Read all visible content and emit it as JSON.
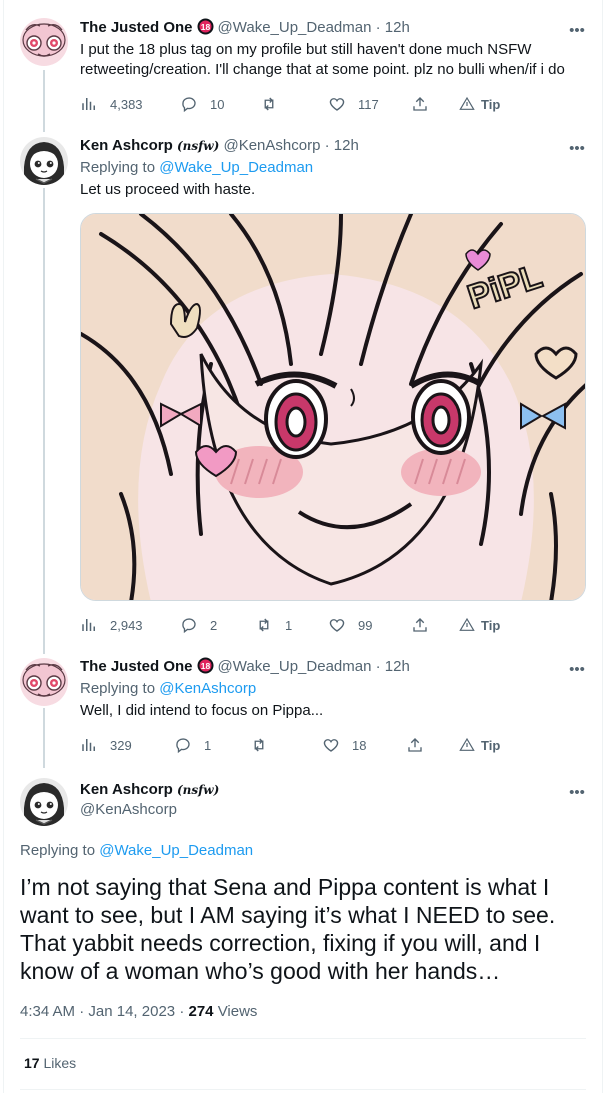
{
  "tweets": [
    {
      "name": "The Justed One",
      "badge": "18",
      "handle": "@Wake_Up_Deadman",
      "sep": "·",
      "time": "12h",
      "text": "I put the 18 plus tag on my profile but still haven't done much NSFW retweeting/creation. I'll change that at some point. plz no bulli when/if i do",
      "views": "4,383",
      "replies": "10",
      "retweets": "",
      "likes": "117",
      "tip": "Tip"
    },
    {
      "name": "Ken Ashcorp",
      "name_tag": "(nsfw)",
      "handle": "@KenAshcorp",
      "sep": "·",
      "time": "12h",
      "replying_prefix": "Replying to",
      "replying_to": "@Wake_Up_Deadman",
      "text": "Let us proceed with haste.",
      "views": "2,943",
      "replies": "2",
      "retweets": "1",
      "likes": "99",
      "tip": "Tip"
    },
    {
      "name": "The Justed One",
      "badge": "18",
      "handle": "@Wake_Up_Deadman",
      "sep": "·",
      "time": "12h",
      "replying_prefix": "Replying to",
      "replying_to": "@KenAshcorp",
      "text": "Well, I did intend to focus on Pippa...",
      "views": "329",
      "replies": "1",
      "retweets": "",
      "likes": "18",
      "tip": "Tip"
    }
  ],
  "main": {
    "name": "Ken Ashcorp",
    "name_tag": "(nsfw)",
    "handle": "@KenAshcorp",
    "replying_prefix": "Replying to",
    "replying_to": "@Wake_Up_Deadman",
    "text": "I’m not saying that Sena and Pippa content is what I want to see, but I AM saying it’s what I NEED to see. That yabbit needs correction, fixing if you will, and I know of a woman who’s good with her hands…",
    "time": "4:34 AM",
    "sep": "·",
    "date": "Jan 14, 2023",
    "views_count": "274",
    "views_label": "Views",
    "likes_count": "17",
    "likes_label": "Likes"
  },
  "media_text": "PiPL",
  "colors": {
    "accent": "#1d9bf0",
    "muted": "#536471",
    "text": "#0f1419",
    "border": "#cfd9de"
  }
}
